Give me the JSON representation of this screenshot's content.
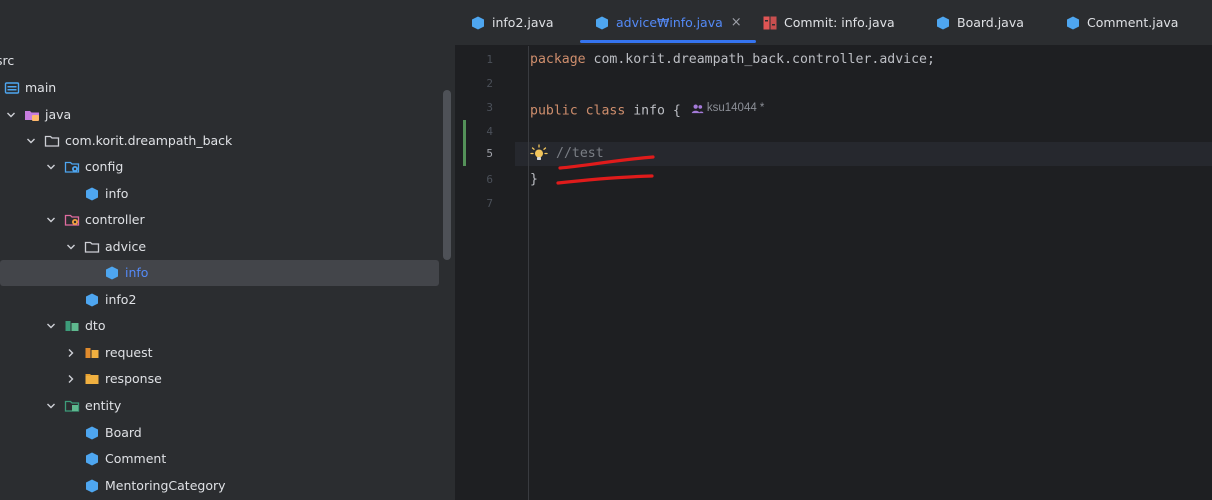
{
  "project_tree": {
    "items": [
      {
        "label": "src",
        "icon": "none"
      },
      {
        "label": "main",
        "icon": "module-folder-icon"
      },
      {
        "label": "java",
        "icon": "source-folder-icon"
      },
      {
        "label": "com.korit.dreampath_back",
        "icon": "package-icon"
      },
      {
        "label": "config",
        "icon": "config-package-icon"
      },
      {
        "label": "info",
        "icon": "class-icon"
      },
      {
        "label": "controller",
        "icon": "controller-package-icon"
      },
      {
        "label": "advice",
        "icon": "package-icon"
      },
      {
        "label": "info",
        "icon": "class-icon",
        "selected": true
      },
      {
        "label": "info2",
        "icon": "class-icon"
      },
      {
        "label": "dto",
        "icon": "dto-package-icon"
      },
      {
        "label": "request",
        "icon": "folder-icon"
      },
      {
        "label": "response",
        "icon": "folder-icon"
      },
      {
        "label": "entity",
        "icon": "entity-package-icon"
      },
      {
        "label": "Board",
        "icon": "class-icon"
      },
      {
        "label": "Comment",
        "icon": "class-icon"
      },
      {
        "label": "MentoringCategory",
        "icon": "class-icon"
      }
    ]
  },
  "tabs": [
    {
      "label": "info2.java",
      "icon": "class-icon"
    },
    {
      "label": "advice₩info.java",
      "icon": "class-icon",
      "active": true,
      "close": "×"
    },
    {
      "label": "Commit: info.java",
      "icon": "diff-icon"
    },
    {
      "label": "Board.java",
      "icon": "class-icon"
    },
    {
      "label": "Comment.java",
      "icon": "class-icon"
    }
  ],
  "editor": {
    "line_numbers": [
      "1",
      "2",
      "3",
      "4",
      "5",
      "6",
      "7"
    ],
    "current_line": "5",
    "lines": {
      "l1_kw": "package",
      "l1_rest": " com.korit.dreampath_back.controller.advice;",
      "l3_kw": "public class",
      "l3_rest": " info {",
      "l3_author": "ksu14044 *",
      "l5_comment": "//test",
      "l6": "}"
    }
  },
  "colors": {
    "accent": "#3574f0",
    "keyword": "#cf8e6d",
    "comment": "#7a7e85",
    "annotation": "#e01b1b",
    "class_icon": "#4ea6f0",
    "change_marker": "#549159"
  }
}
